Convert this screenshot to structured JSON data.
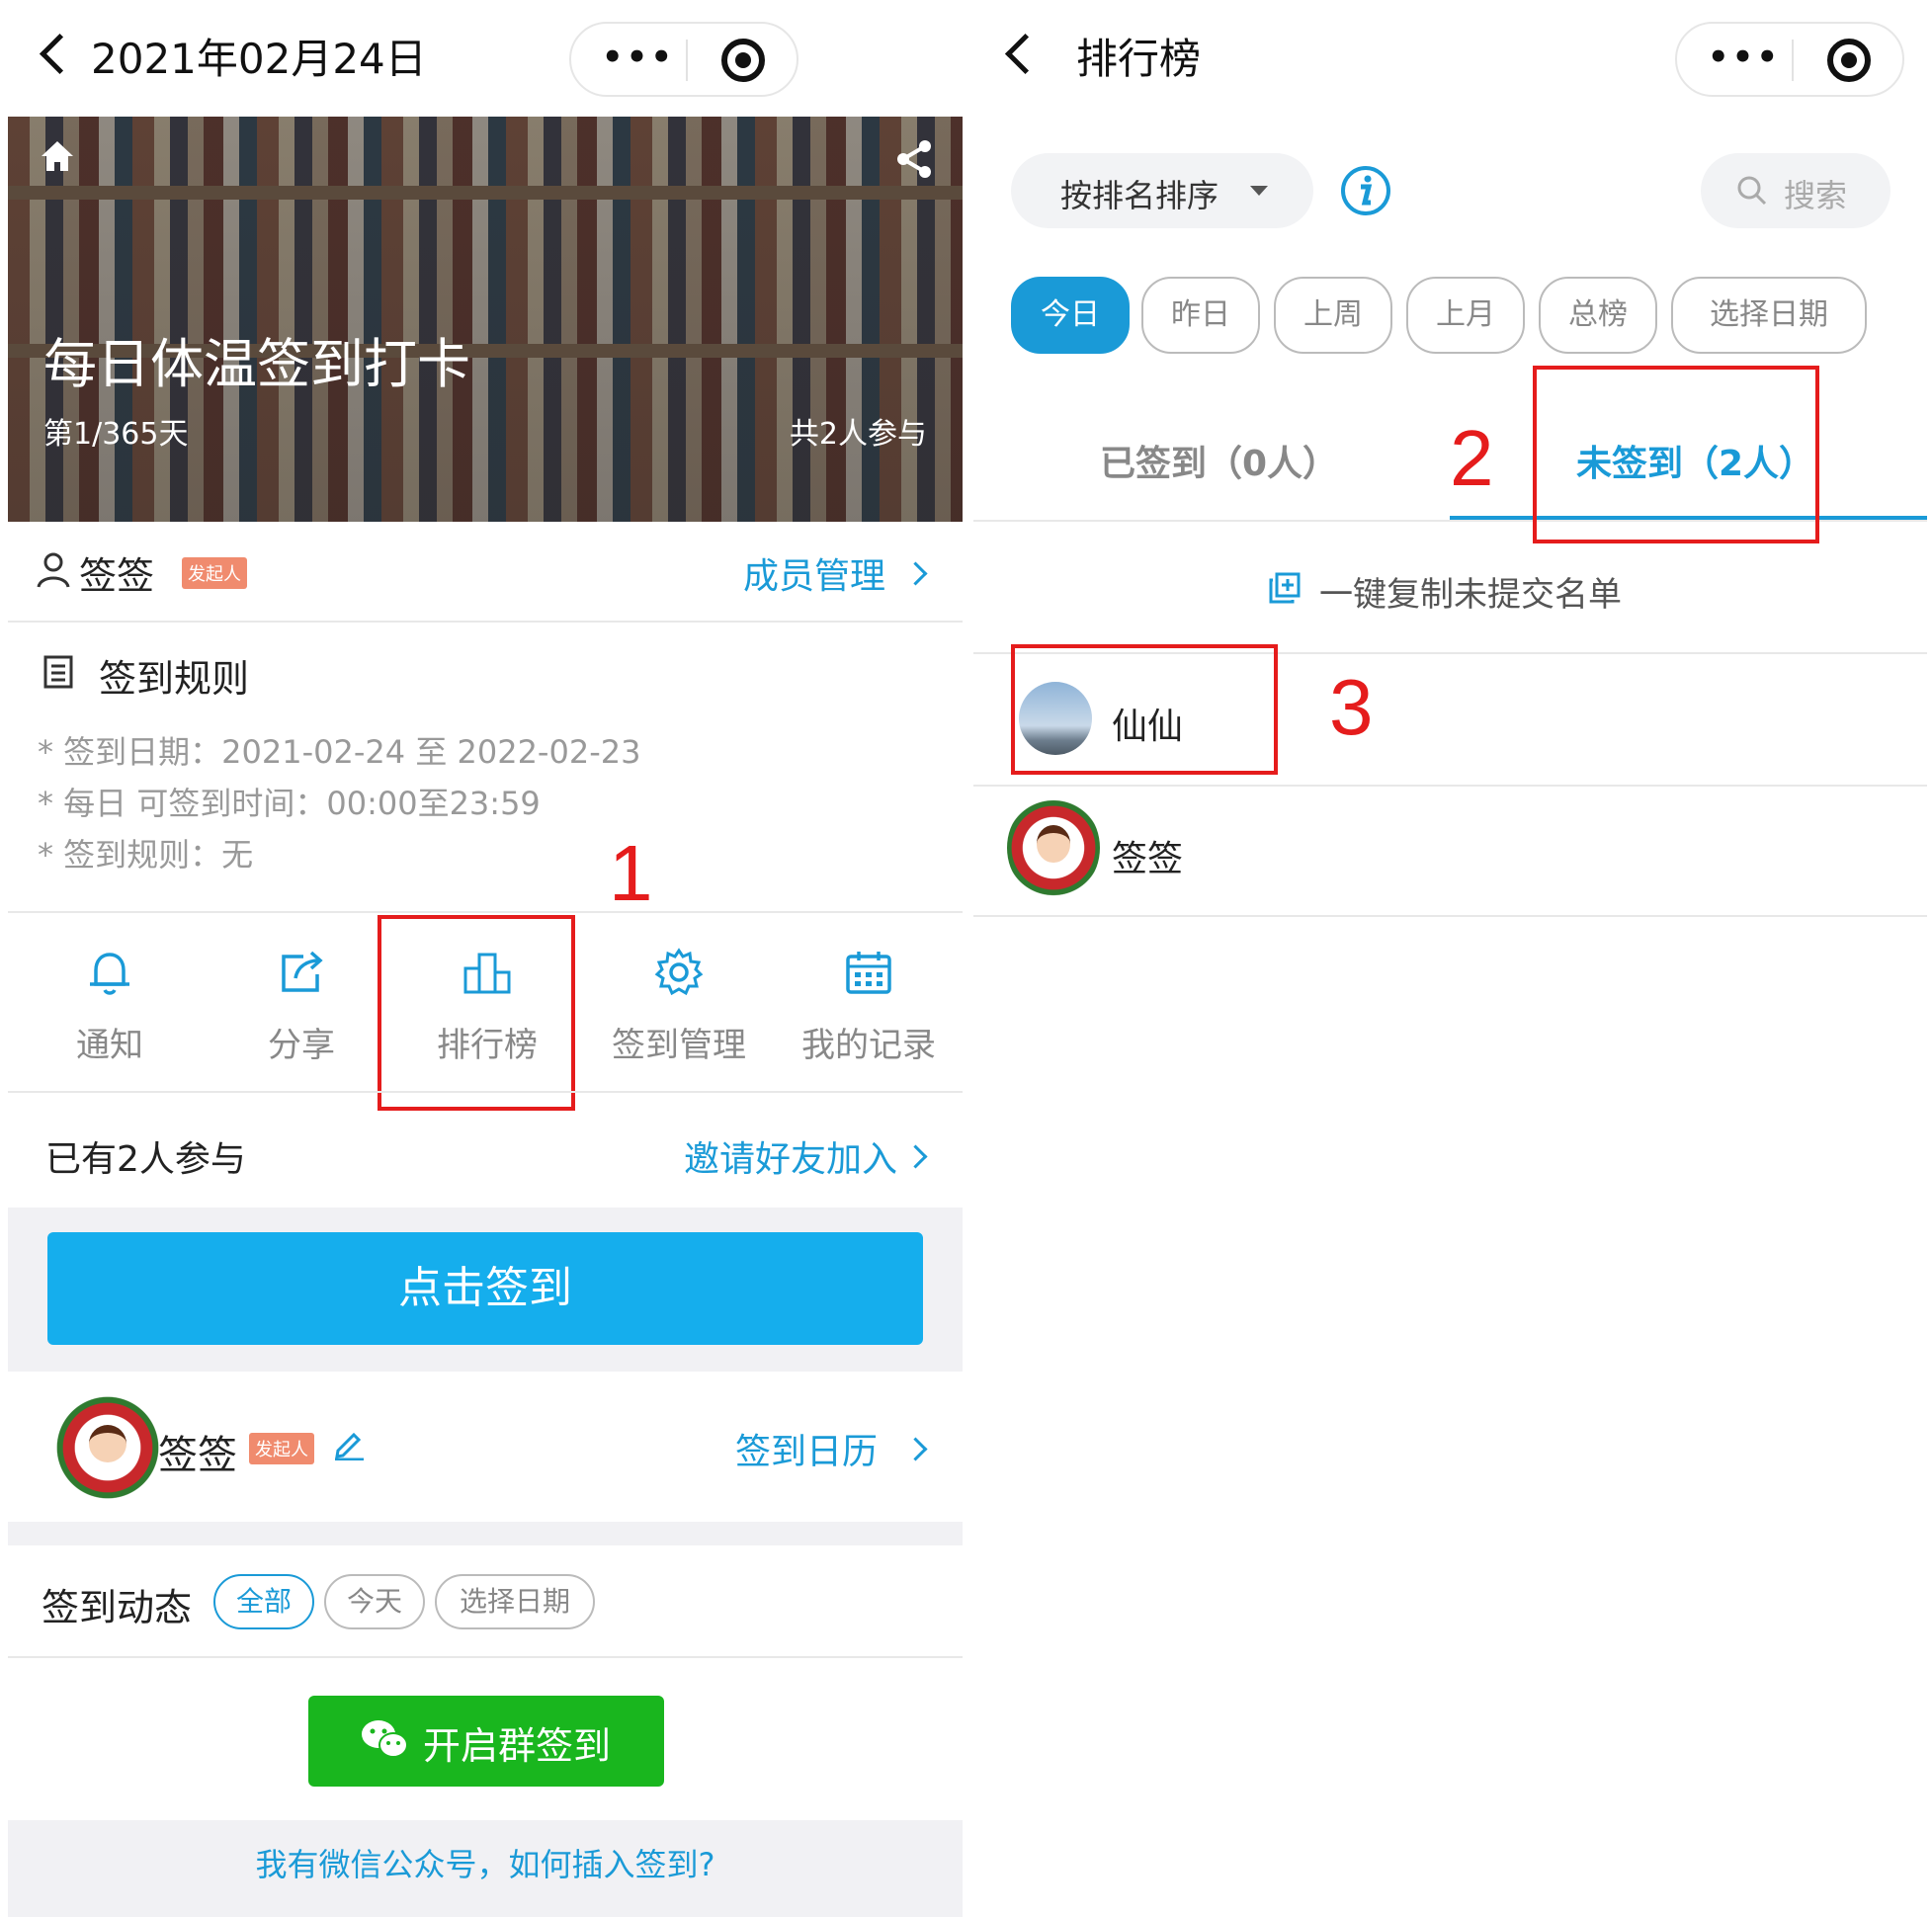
{
  "left": {
    "nav": {
      "title": "2021年02月24日",
      "more": "•••"
    },
    "banner": {
      "title": "每日体温签到打卡",
      "day": "第1/365天",
      "participants": "共2人参与"
    },
    "owner": {
      "name": "签签",
      "badge": "发起人",
      "manage": "成员管理"
    },
    "rules": {
      "heading": "签到规则",
      "items": [
        "* 签到日期：2021-02-24 至 2022-02-23",
        "* 每日 可签到时间：00:00至23:59",
        "* 签到规则：无"
      ]
    },
    "functions": [
      {
        "label": "通知",
        "icon": "bell-icon"
      },
      {
        "label": "分享",
        "icon": "share-out-icon"
      },
      {
        "label": "排行榜",
        "icon": "podium-icon"
      },
      {
        "label": "签到管理",
        "icon": "gear-icon"
      },
      {
        "label": "我的记录",
        "icon": "calendar-icon"
      }
    ],
    "participants": {
      "text": "已有2人参与",
      "invite": "邀请好友加入"
    },
    "checkin_button": "点击签到",
    "me": {
      "name": "签签",
      "badge": "发起人",
      "calendar": "签到日历"
    },
    "activity": {
      "heading": "签到动态",
      "filters": [
        "全部",
        "今天",
        "选择日期"
      ]
    },
    "group_button": "开启群签到",
    "footer_link": "我有微信公众号，如何插入签到?"
  },
  "right": {
    "nav": {
      "title": "排行榜",
      "more": "•••"
    },
    "sort": {
      "label": "按排名排序",
      "search": "搜索"
    },
    "periods": [
      "今日",
      "昨日",
      "上周",
      "上月",
      "总榜",
      "选择日期"
    ],
    "tabs": {
      "signed": "已签到（0人）",
      "unsigned": "未签到（2人）"
    },
    "copy_list": "一键复制未提交名单",
    "members": [
      {
        "name": "仙仙"
      },
      {
        "name": "签签"
      }
    ]
  },
  "annotations": [
    "1",
    "2",
    "3"
  ],
  "colors": {
    "accent": "#1a9ad7",
    "checkin_button": "#15aeed",
    "group_button": "#19b61e",
    "annotation": "#e51c1c",
    "badge": "#f08b6e"
  }
}
